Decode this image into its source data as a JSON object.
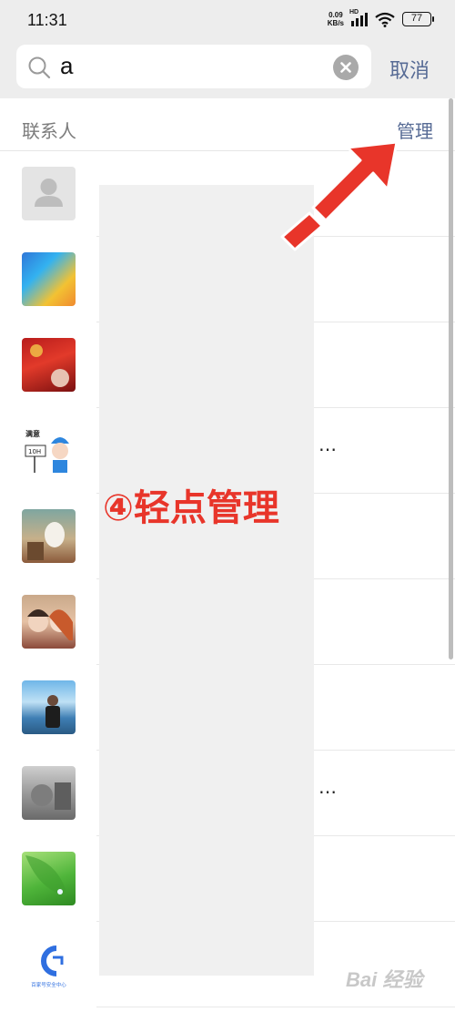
{
  "status_bar": {
    "time": "11:31",
    "net_speed_value": "0.09",
    "net_speed_unit": "KB/s",
    "network_badge": "HD",
    "battery": "77"
  },
  "search": {
    "value": "a",
    "cancel_label": "取消"
  },
  "section": {
    "title": "联系人",
    "manage_label": "管理"
  },
  "contacts": [
    {
      "avatar": "default-person-avatar",
      "name_suffix": ""
    },
    {
      "avatar": "blue-gradient-avatar",
      "name_suffix": ""
    },
    {
      "avatar": "red-photo-avatar",
      "name_suffix": ""
    },
    {
      "avatar": "cartoon-worker-avatar",
      "name_suffix": "…"
    },
    {
      "avatar": "moomin-avatar",
      "name_suffix": ""
    },
    {
      "avatar": "couple-illustration-avatar",
      "name_suffix": ""
    },
    {
      "avatar": "seaside-person-avatar",
      "name_suffix": ""
    },
    {
      "avatar": "machine-photo-avatar",
      "name_suffix": "…"
    },
    {
      "avatar": "green-leaf-avatar",
      "name_suffix": ""
    },
    {
      "avatar": "security-center-logo-avatar",
      "name_suffix": ""
    }
  ],
  "worker_avatar_text": {
    "top": "满意",
    "sign": "10H"
  },
  "logo_avatar_text": "百家号安全中心",
  "annotation": {
    "label": "④轻点管理"
  },
  "watermark": "Bai 经验",
  "colors": {
    "link": "#576b95",
    "annotation": "#e8352a",
    "header_bg": "#ededed"
  }
}
